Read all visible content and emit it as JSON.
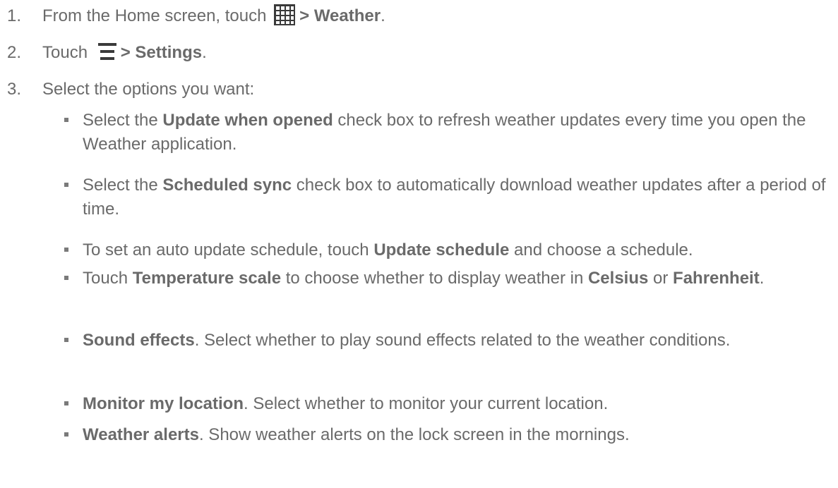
{
  "steps": [
    {
      "num": "1.",
      "before": "From the Home screen, touch",
      "icon": "apps-grid-icon",
      "action": "> Weather",
      "after": "."
    },
    {
      "num": "2.",
      "before": "Touch",
      "icon": "menu-icon",
      "action": "> Settings",
      "after": "."
    },
    {
      "num": "3.",
      "text": "Select the options you want:"
    }
  ],
  "bullets": [
    {
      "t1": "Select the ",
      "b1": "Update when opened",
      "t2": " check box to refresh weather updates every time you open the Weather application."
    },
    {
      "t1": "Select the ",
      "b1": "Scheduled sync",
      "t2": " check box to automatically download weather updates after a period of time."
    },
    {
      "t1": "To set an auto update schedule, touch ",
      "b1": "Update schedule",
      "t2": " and choose a schedule."
    },
    {
      "t1": "Touch ",
      "b1": "Temperature scale",
      "t2": " to choose whether to display weather in ",
      "b2": "Celsius",
      "t3": " or ",
      "b3": "Fahrenheit",
      "t4": "."
    },
    {
      "b1": "Sound effects",
      "t2": ". Select whether to play sound effects related to the weather conditions."
    },
    {
      "b1": "Monitor my location",
      "t2": ". Select whether to monitor your current location."
    },
    {
      "b1": "Weather alerts",
      "t2": ". Show weather alerts on the lock screen in the mornings."
    }
  ],
  "colors": {
    "text": "#6a6a6a",
    "icon": "#3a3a3a"
  }
}
